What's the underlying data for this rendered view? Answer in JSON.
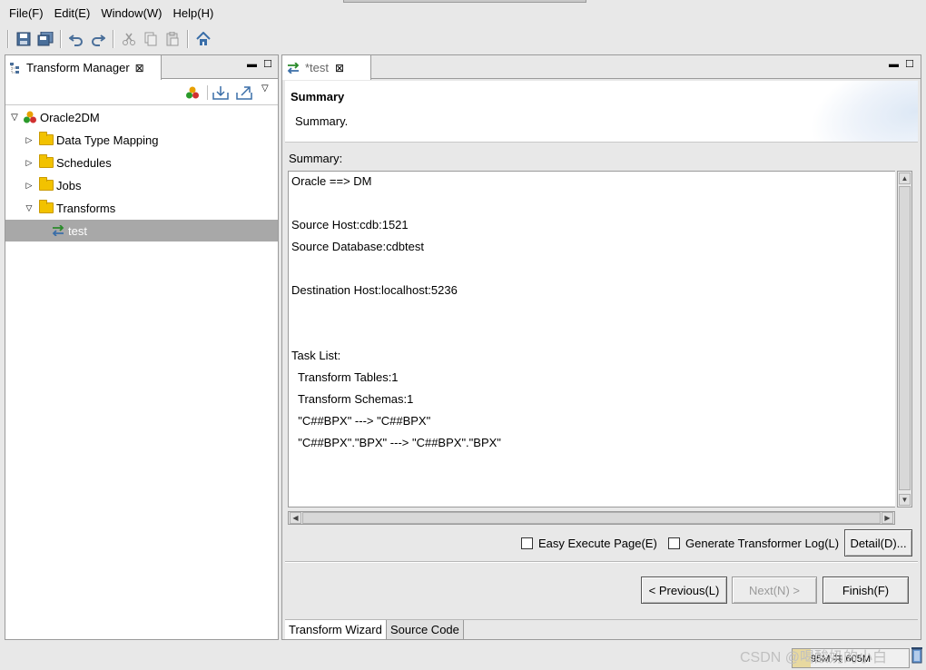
{
  "menu": [
    {
      "label": "File",
      "key": "(F)"
    },
    {
      "label": "Edit",
      "key": "(E)"
    },
    {
      "label": "Window",
      "key": "(W)"
    },
    {
      "label": "Help",
      "key": "(H)"
    }
  ],
  "left_view": {
    "tab_label": "Transform Manager",
    "tree": {
      "root": "Oracle2DM",
      "items": [
        "Data Type Mapping",
        "Schedules",
        "Jobs",
        "Transforms"
      ],
      "selected_child": "test"
    }
  },
  "editor": {
    "tab_label": "*test",
    "page_title": "Summary",
    "page_description": "Summary.",
    "summary_label": "Summary:",
    "summary_lines": [
      "Oracle ==> DM",
      "",
      "Source Host:cdb:1521",
      "Source Database:cdbtest",
      "",
      "Destination Host:localhost:5236",
      "",
      "",
      "Task List:",
      "  Transform Tables:1",
      "  Transform Schemas:1",
      "  \"C##BPX\" ---> \"C##BPX\"",
      "  \"C##BPX\".\"BPX\" ---> \"C##BPX\".\"BPX\""
    ],
    "easy_execute_label": "Easy Execute Page(E)",
    "gen_log_label": "Generate Transformer Log(L)",
    "detail_label": "Detail(D)...",
    "previous_label": "< Previous(L)",
    "next_label": "Next(N) >",
    "finish_label": "Finish(F)",
    "bottom_tabs": [
      "Transform Wizard",
      "Source Code"
    ]
  },
  "status": {
    "memory_text": "95M 共 605M",
    "memory_fraction": 0.16,
    "watermark": "CSDN @喝酸奶的小白"
  },
  "colors": {
    "selection": "#a8a8a8",
    "folder": "#f2c200",
    "toolbar_icon": "#3a6ea8"
  }
}
